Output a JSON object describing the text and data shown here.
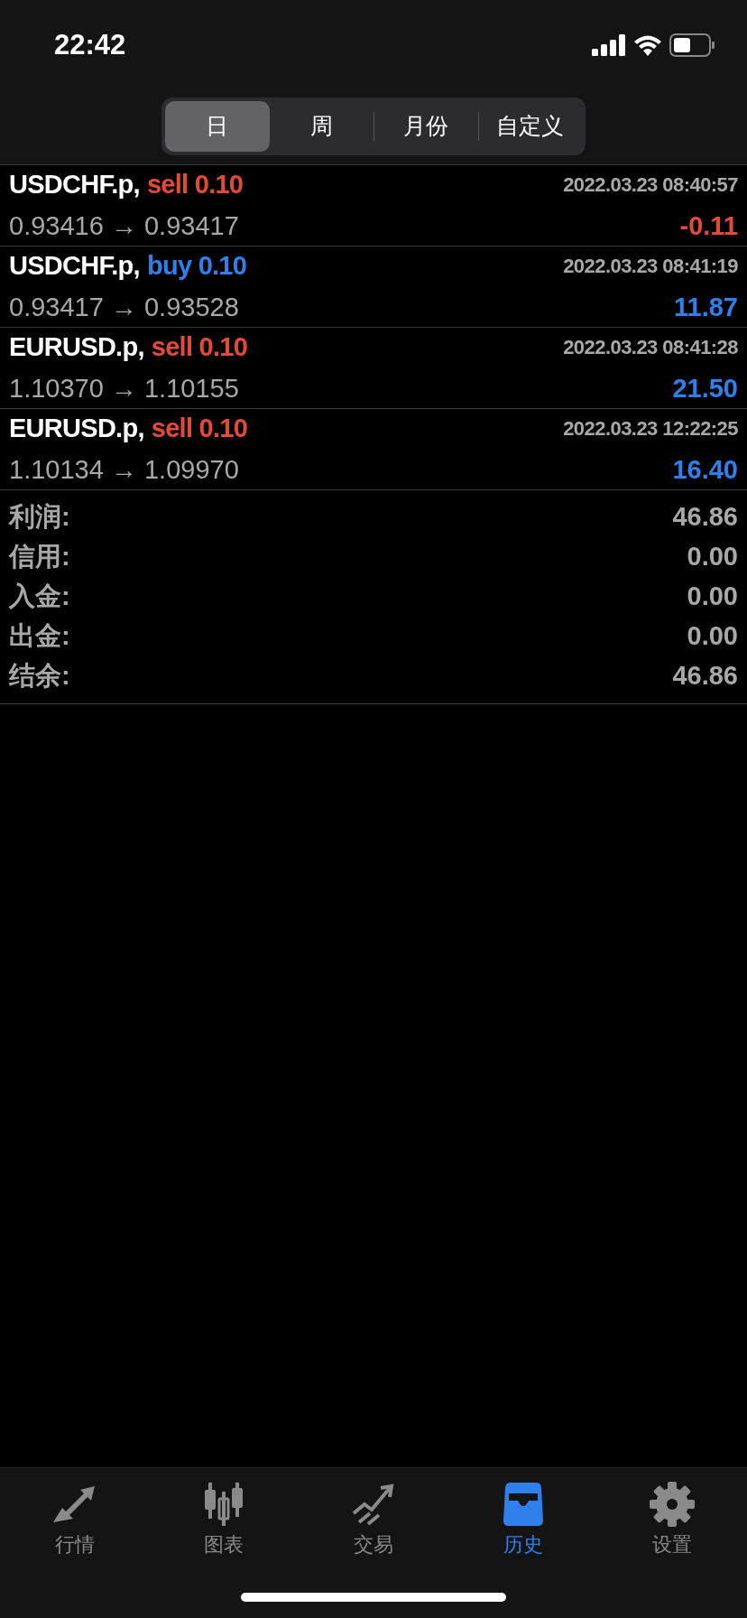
{
  "status_bar": {
    "time": "22:42"
  },
  "tabs": [
    {
      "label": "日",
      "selected": true
    },
    {
      "label": "周",
      "selected": false
    },
    {
      "label": "月份",
      "selected": false
    },
    {
      "label": "自定义",
      "selected": false
    }
  ],
  "trades": [
    {
      "symbol": "USDCHF.p,",
      "order": {
        "text": "sell 0.10",
        "color": "#e5493a"
      },
      "time": "2022.03.23 08:40:57",
      "prices": "0.93416 → 0.93417",
      "profit": {
        "text": "-0.11",
        "color": "#e5493a"
      }
    },
    {
      "symbol": "USDCHF.p,",
      "order": {
        "text": "buy 0.10",
        "color": "#2f80ed"
      },
      "time": "2022.03.23 08:41:19",
      "prices": "0.93417 → 0.93528",
      "profit": {
        "text": "11.87",
        "color": "#2f80ed"
      }
    },
    {
      "symbol": "EURUSD.p,",
      "order": {
        "text": "sell 0.10",
        "color": "#e5493a"
      },
      "time": "2022.03.23 08:41:28",
      "prices": "1.10370 → 1.10155",
      "profit": {
        "text": "21.50",
        "color": "#2f80ed"
      }
    },
    {
      "symbol": "EURUSD.p,",
      "order": {
        "text": "sell 0.10",
        "color": "#e5493a"
      },
      "time": "2022.03.23 12:22:25",
      "prices": "1.10134 → 1.09970",
      "profit": {
        "text": "16.40",
        "color": "#2f80ed"
      }
    }
  ],
  "summary": [
    {
      "label": "利润:",
      "value": "46.86"
    },
    {
      "label": "信用:",
      "value": "0.00"
    },
    {
      "label": "入金:",
      "value": "0.00"
    },
    {
      "label": "出金:",
      "value": "0.00"
    },
    {
      "label": "结余:",
      "value": "46.86"
    }
  ],
  "nav": [
    {
      "kind": "quotes",
      "label": "行情",
      "selected": false
    },
    {
      "kind": "chart",
      "label": "图表",
      "selected": false
    },
    {
      "kind": "trade",
      "label": "交易",
      "selected": false
    },
    {
      "kind": "history",
      "label": "历史",
      "selected": true
    },
    {
      "kind": "settings",
      "label": "设置",
      "selected": false
    }
  ]
}
